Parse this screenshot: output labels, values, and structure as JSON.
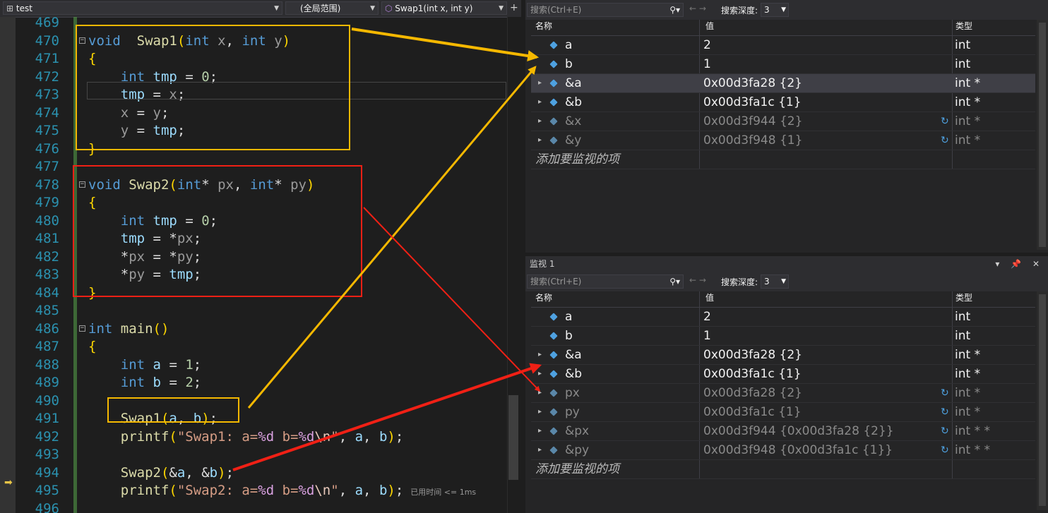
{
  "editor": {
    "nav": {
      "project": "test",
      "scope": "(全局范围)",
      "function": "Swap1(int x, int y)"
    },
    "hint": "已用时间 <= 1ms",
    "lines": [
      {
        "n": "469",
        "tokens": []
      },
      {
        "n": "470",
        "fold": true,
        "tokens": [
          [
            "kw",
            "void"
          ],
          [
            "",
            "  "
          ],
          [
            "fn",
            "Swap1"
          ],
          [
            "br",
            "("
          ],
          [
            "kw",
            "int"
          ],
          [
            "",
            " "
          ],
          [
            "pm",
            "x"
          ],
          [
            "",
            ", "
          ],
          [
            "kw",
            "int"
          ],
          [
            "",
            " "
          ],
          [
            "pm",
            "y"
          ],
          [
            "br",
            ")"
          ]
        ]
      },
      {
        "n": "471",
        "tokens": [
          [
            "br",
            "{"
          ]
        ]
      },
      {
        "n": "472",
        "tokens": [
          [
            "",
            "    "
          ],
          [
            "kw",
            "int"
          ],
          [
            "",
            " "
          ],
          [
            "lv",
            "tmp"
          ],
          [
            "",
            " = "
          ],
          [
            "num",
            "0"
          ],
          [
            "",
            ";"
          ]
        ]
      },
      {
        "n": "473",
        "tokens": [
          [
            "",
            "    "
          ],
          [
            "lv",
            "tmp"
          ],
          [
            "",
            " = "
          ],
          [
            "pm",
            "x"
          ],
          [
            "",
            ";"
          ]
        ]
      },
      {
        "n": "474",
        "tokens": [
          [
            "",
            "    "
          ],
          [
            "pm",
            "x"
          ],
          [
            "",
            " = "
          ],
          [
            "pm",
            "y"
          ],
          [
            "",
            ";"
          ]
        ]
      },
      {
        "n": "475",
        "tokens": [
          [
            "",
            "    "
          ],
          [
            "pm",
            "y"
          ],
          [
            "",
            " = "
          ],
          [
            "lv",
            "tmp"
          ],
          [
            "",
            ";"
          ]
        ]
      },
      {
        "n": "476",
        "tokens": [
          [
            "br",
            "}"
          ]
        ]
      },
      {
        "n": "477",
        "tokens": []
      },
      {
        "n": "478",
        "fold": true,
        "tokens": [
          [
            "kw",
            "void"
          ],
          [
            "",
            " "
          ],
          [
            "fn",
            "Swap2"
          ],
          [
            "br",
            "("
          ],
          [
            "kw",
            "int"
          ],
          [
            "",
            "* "
          ],
          [
            "pm",
            "px"
          ],
          [
            "",
            ", "
          ],
          [
            "kw",
            "int"
          ],
          [
            "",
            "* "
          ],
          [
            "pm",
            "py"
          ],
          [
            "br",
            ")"
          ]
        ]
      },
      {
        "n": "479",
        "tokens": [
          [
            "br",
            "{"
          ]
        ]
      },
      {
        "n": "480",
        "tokens": [
          [
            "",
            "    "
          ],
          [
            "kw",
            "int"
          ],
          [
            "",
            " "
          ],
          [
            "lv",
            "tmp"
          ],
          [
            "",
            " = "
          ],
          [
            "num",
            "0"
          ],
          [
            "",
            ";"
          ]
        ]
      },
      {
        "n": "481",
        "tokens": [
          [
            "",
            "    "
          ],
          [
            "lv",
            "tmp"
          ],
          [
            "",
            " = *"
          ],
          [
            "pm",
            "px"
          ],
          [
            "",
            ";"
          ]
        ]
      },
      {
        "n": "482",
        "tokens": [
          [
            "",
            "    *"
          ],
          [
            "pm",
            "px"
          ],
          [
            "",
            " = *"
          ],
          [
            "pm",
            "py"
          ],
          [
            "",
            ";"
          ]
        ]
      },
      {
        "n": "483",
        "tokens": [
          [
            "",
            "    *"
          ],
          [
            "pm",
            "py"
          ],
          [
            "",
            " = "
          ],
          [
            "lv",
            "tmp"
          ],
          [
            "",
            ";"
          ]
        ]
      },
      {
        "n": "484",
        "tokens": [
          [
            "br",
            "}"
          ]
        ]
      },
      {
        "n": "485",
        "tokens": []
      },
      {
        "n": "486",
        "fold": true,
        "tokens": [
          [
            "kw",
            "int"
          ],
          [
            "",
            " "
          ],
          [
            "fn",
            "main"
          ],
          [
            "br",
            "()"
          ]
        ]
      },
      {
        "n": "487",
        "tokens": [
          [
            "br",
            "{"
          ]
        ]
      },
      {
        "n": "488",
        "tokens": [
          [
            "",
            "    "
          ],
          [
            "kw",
            "int"
          ],
          [
            "",
            " "
          ],
          [
            "lv",
            "a"
          ],
          [
            "",
            " = "
          ],
          [
            "num",
            "1"
          ],
          [
            "",
            ";"
          ]
        ]
      },
      {
        "n": "489",
        "tokens": [
          [
            "",
            "    "
          ],
          [
            "kw",
            "int"
          ],
          [
            "",
            " "
          ],
          [
            "lv",
            "b"
          ],
          [
            "",
            " = "
          ],
          [
            "num",
            "2"
          ],
          [
            "",
            ";"
          ]
        ]
      },
      {
        "n": "490",
        "tokens": []
      },
      {
        "n": "491",
        "tokens": [
          [
            "",
            "    "
          ],
          [
            "fn",
            "Swap1"
          ],
          [
            "br",
            "("
          ],
          [
            "lv",
            "a"
          ],
          [
            "",
            ", "
          ],
          [
            "lv",
            "b"
          ],
          [
            "br",
            ")"
          ],
          [
            "",
            ";"
          ]
        ]
      },
      {
        "n": "492",
        "tokens": [
          [
            "",
            "    "
          ],
          [
            "fn",
            "printf"
          ],
          [
            "br",
            "("
          ],
          [
            "str",
            "\"Swap1: a="
          ],
          [
            "fmt",
            "%d"
          ],
          [
            "str",
            " b="
          ],
          [
            "fmt",
            "%d"
          ],
          [
            "esc",
            "\\n"
          ],
          [
            "str",
            "\""
          ],
          [
            "",
            ", "
          ],
          [
            "lv",
            "a"
          ],
          [
            "",
            ", "
          ],
          [
            "lv",
            "b"
          ],
          [
            "br",
            ")"
          ],
          [
            "",
            ";"
          ]
        ]
      },
      {
        "n": "493",
        "tokens": []
      },
      {
        "n": "494",
        "tokens": [
          [
            "",
            "    "
          ],
          [
            "fn",
            "Swap2"
          ],
          [
            "br",
            "("
          ],
          [
            "",
            "&"
          ],
          [
            "lv",
            "a"
          ],
          [
            "",
            ", &"
          ],
          [
            "lv",
            "b"
          ],
          [
            "br",
            ")"
          ],
          [
            "",
            ";"
          ]
        ]
      },
      {
        "n": "495",
        "hint": true,
        "tokens": [
          [
            "",
            "    "
          ],
          [
            "fn",
            "printf"
          ],
          [
            "br",
            "("
          ],
          [
            "str",
            "\"Swap2: a="
          ],
          [
            "fmt",
            "%d"
          ],
          [
            "str",
            " b="
          ],
          [
            "fmt",
            "%d"
          ],
          [
            "esc",
            "\\n"
          ],
          [
            "str",
            "\""
          ],
          [
            "",
            ", "
          ],
          [
            "lv",
            "a"
          ],
          [
            "",
            ", "
          ],
          [
            "lv",
            "b"
          ],
          [
            "br",
            ")"
          ],
          [
            "",
            ";"
          ]
        ]
      },
      {
        "n": "496",
        "tokens": []
      }
    ]
  },
  "watchTop": {
    "search_placeholder": "搜索(Ctrl+E)",
    "depth_label": "搜索深度:",
    "depth_value": "3",
    "headers": {
      "name": "名称",
      "value": "值",
      "type": "类型"
    },
    "rows": [
      {
        "name": "a",
        "value": "2",
        "type": "int",
        "expand": false,
        "stale": false,
        "refresh": false,
        "sel": false
      },
      {
        "name": "b",
        "value": "1",
        "type": "int",
        "expand": false,
        "stale": false,
        "refresh": false,
        "sel": false
      },
      {
        "name": "&a",
        "value": "0x00d3fa28 {2}",
        "type": "int *",
        "expand": true,
        "stale": false,
        "refresh": false,
        "sel": true
      },
      {
        "name": "&b",
        "value": "0x00d3fa1c {1}",
        "type": "int *",
        "expand": true,
        "stale": false,
        "refresh": false,
        "sel": false
      },
      {
        "name": "&x",
        "value": "0x00d3f944 {2}",
        "type": "int *",
        "expand": true,
        "stale": true,
        "refresh": true,
        "sel": false
      },
      {
        "name": "&y",
        "value": "0x00d3f948 {1}",
        "type": "int *",
        "expand": true,
        "stale": true,
        "refresh": true,
        "sel": false
      }
    ],
    "add_item": "添加要监视的项"
  },
  "watchBot": {
    "title": "监视 1",
    "title_buttons": "▾ 📌 ✕",
    "search_placeholder": "搜索(Ctrl+E)",
    "depth_label": "搜索深度:",
    "depth_value": "3",
    "headers": {
      "name": "名称",
      "value": "值",
      "type": "类型"
    },
    "rows": [
      {
        "name": "a",
        "value": "2",
        "type": "int",
        "expand": false,
        "stale": false,
        "refresh": false
      },
      {
        "name": "b",
        "value": "1",
        "type": "int",
        "expand": false,
        "stale": false,
        "refresh": false
      },
      {
        "name": "&a",
        "value": "0x00d3fa28 {2}",
        "type": "int *",
        "expand": true,
        "stale": false,
        "refresh": false
      },
      {
        "name": "&b",
        "value": "0x00d3fa1c {1}",
        "type": "int *",
        "expand": true,
        "stale": false,
        "refresh": false
      },
      {
        "name": "px",
        "value": "0x00d3fa28 {2}",
        "type": "int *",
        "expand": true,
        "stale": true,
        "refresh": true
      },
      {
        "name": "py",
        "value": "0x00d3fa1c {1}",
        "type": "int *",
        "expand": true,
        "stale": true,
        "refresh": true
      },
      {
        "name": "&px",
        "value": "0x00d3f944 {0x00d3fa28 {2}}",
        "type": "int * *",
        "expand": true,
        "stale": true,
        "refresh": true
      },
      {
        "name": "&py",
        "value": "0x00d3f948 {0x00d3fa1c {1}}",
        "type": "int * *",
        "expand": true,
        "stale": true,
        "refresh": true
      }
    ],
    "add_item": "添加要监视的项"
  },
  "colors": {
    "annot_yellow": "#f5b800",
    "annot_red": "#f02015"
  }
}
